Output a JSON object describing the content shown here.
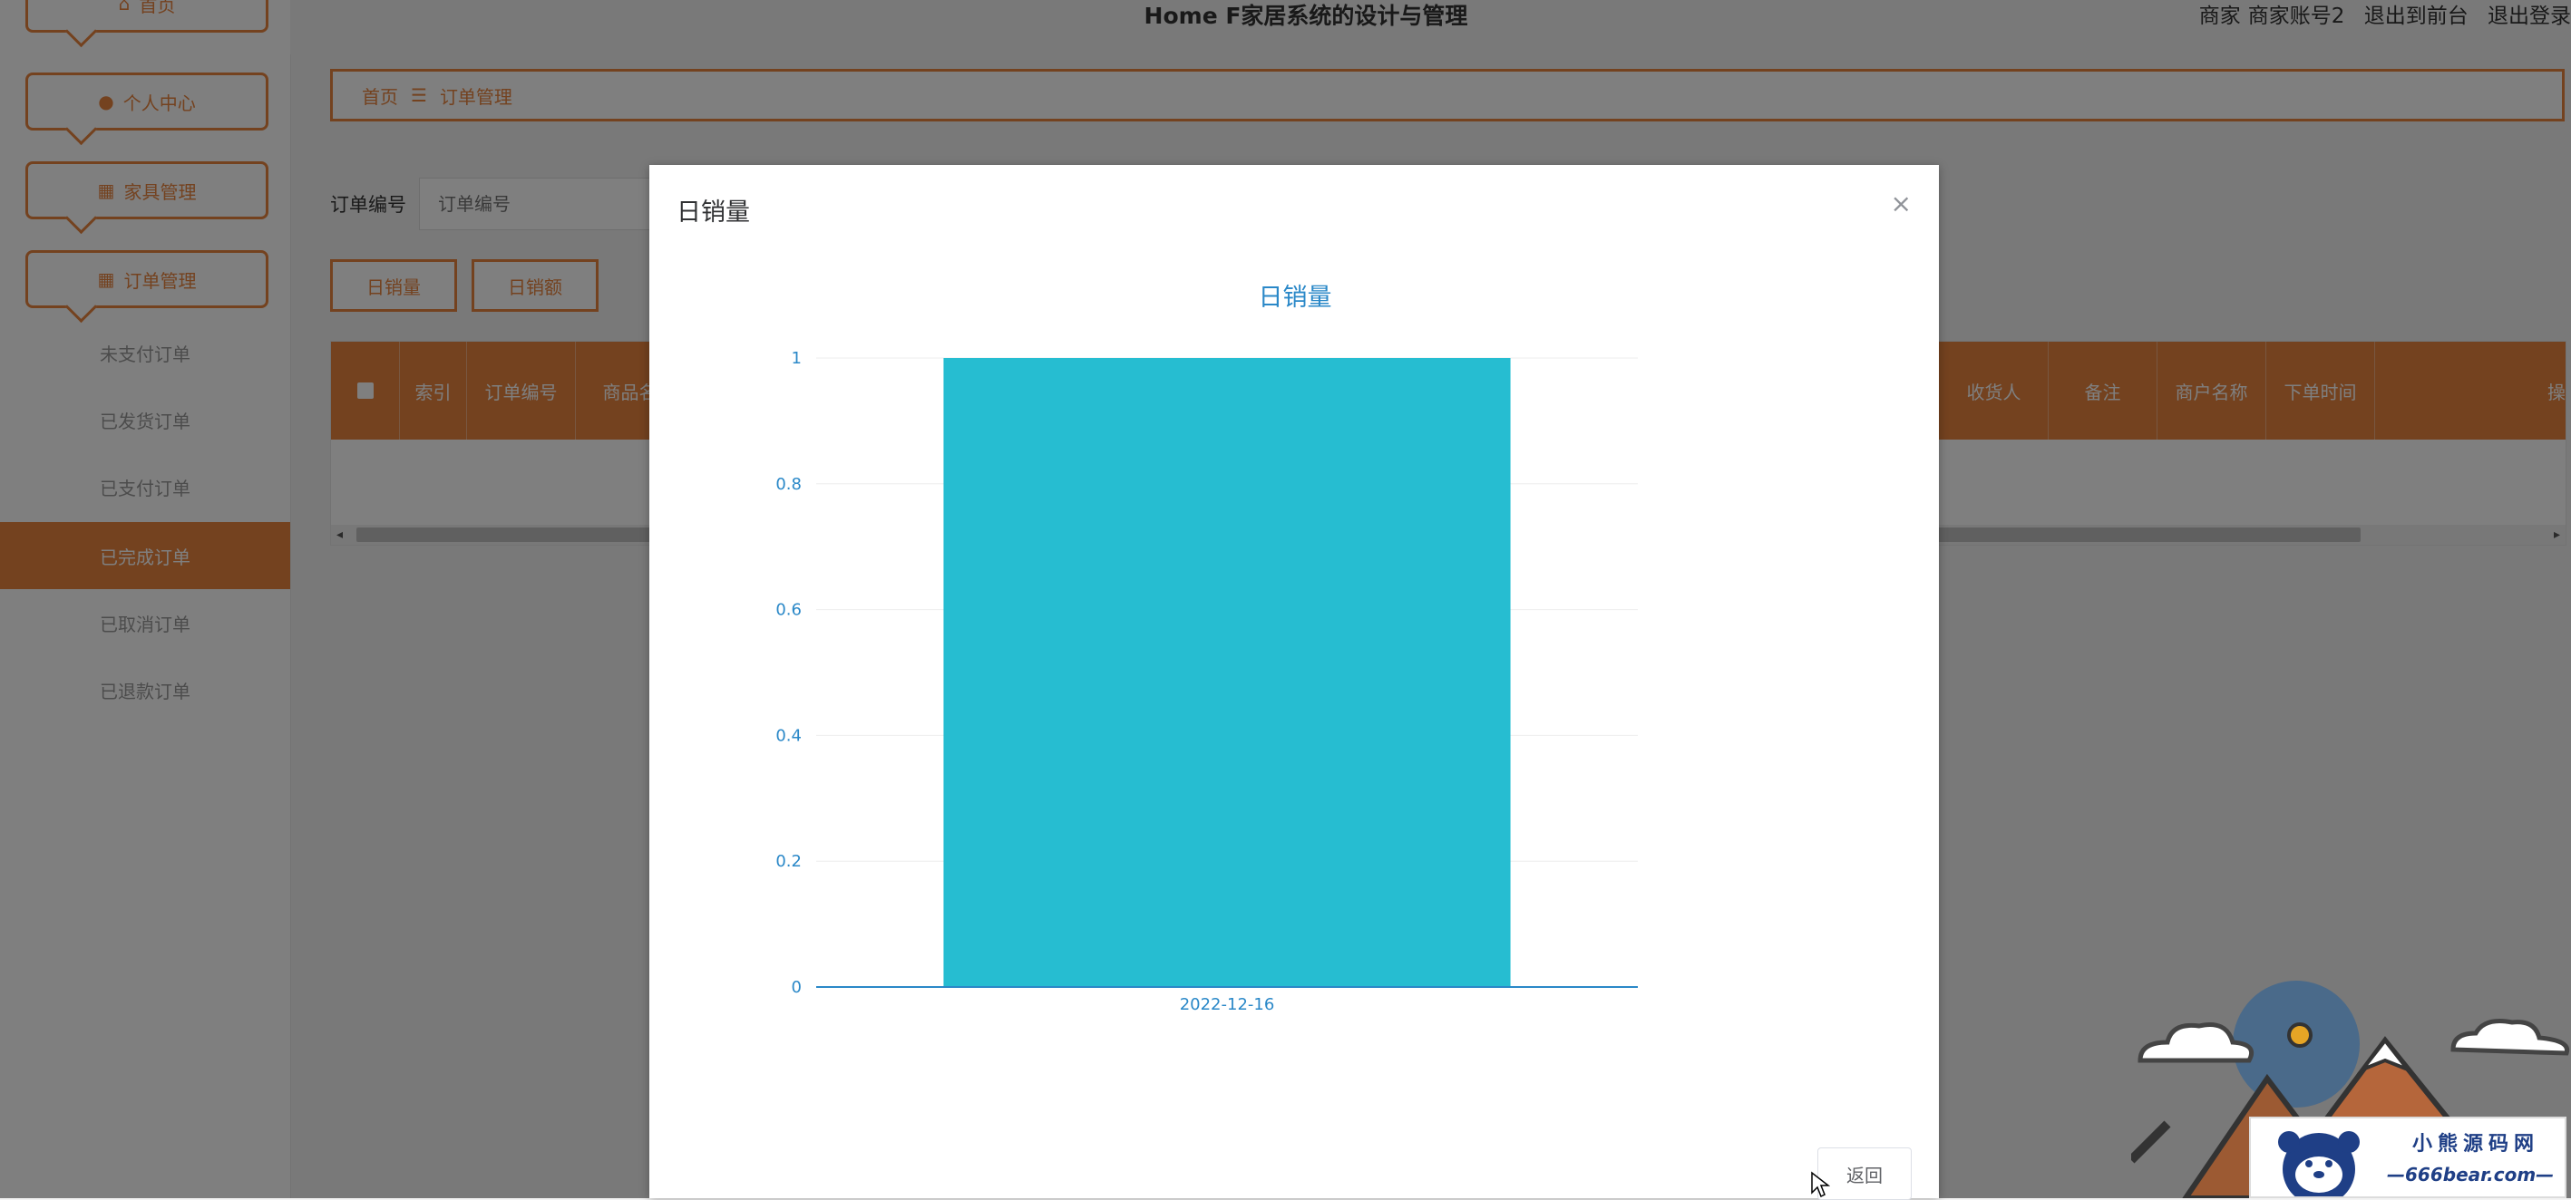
{
  "app_title": "Home F家居系统的设计与管理",
  "user": {
    "role": "商家",
    "account": "商家账号2",
    "to_front": "退出到前台",
    "logout": "退出登录"
  },
  "menu": [
    {
      "label": "首页",
      "icon": "home-icon"
    },
    {
      "label": "个人中心",
      "icon": "user-icon"
    },
    {
      "label": "家具管理",
      "icon": "grid-icon"
    },
    {
      "label": "订单管理",
      "icon": "grid-icon"
    }
  ],
  "submenu": [
    "未支付订单",
    "已发货订单",
    "已支付订单",
    "已完成订单",
    "已取消订单",
    "已退款订单"
  ],
  "submenu_active": "已完成订单",
  "breadcrumb": {
    "home": "首页",
    "sep": "☰",
    "current": "订单管理"
  },
  "search": {
    "label": "订单编号",
    "placeholder": "订单编号"
  },
  "buttons": {
    "daily_sales_volume": "日销量",
    "daily_sales_amount": "日销额"
  },
  "table_headers_left": [
    "索引",
    "订单编号",
    "商品名"
  ],
  "table_headers_right": [
    "收货人",
    "备注",
    "商户名称",
    "下单时间",
    "操"
  ],
  "modal": {
    "title": "日销量",
    "close": "×",
    "return_label": "返回"
  },
  "colors": {
    "accent": "#e8843f",
    "bar": "#26bdd1",
    "axis": "#2a88c8"
  },
  "watermark": {
    "line1": "小熊源码网",
    "line2": "—666bear.com—"
  },
  "chart_data": {
    "type": "bar",
    "title": "日销量",
    "categories": [
      "2022-12-16"
    ],
    "values": [
      1
    ],
    "ylim": [
      0,
      1
    ],
    "yticks": [
      0,
      0.2,
      0.4,
      0.6,
      0.8,
      1
    ],
    "xlabel": "",
    "ylabel": "",
    "grid": true
  }
}
